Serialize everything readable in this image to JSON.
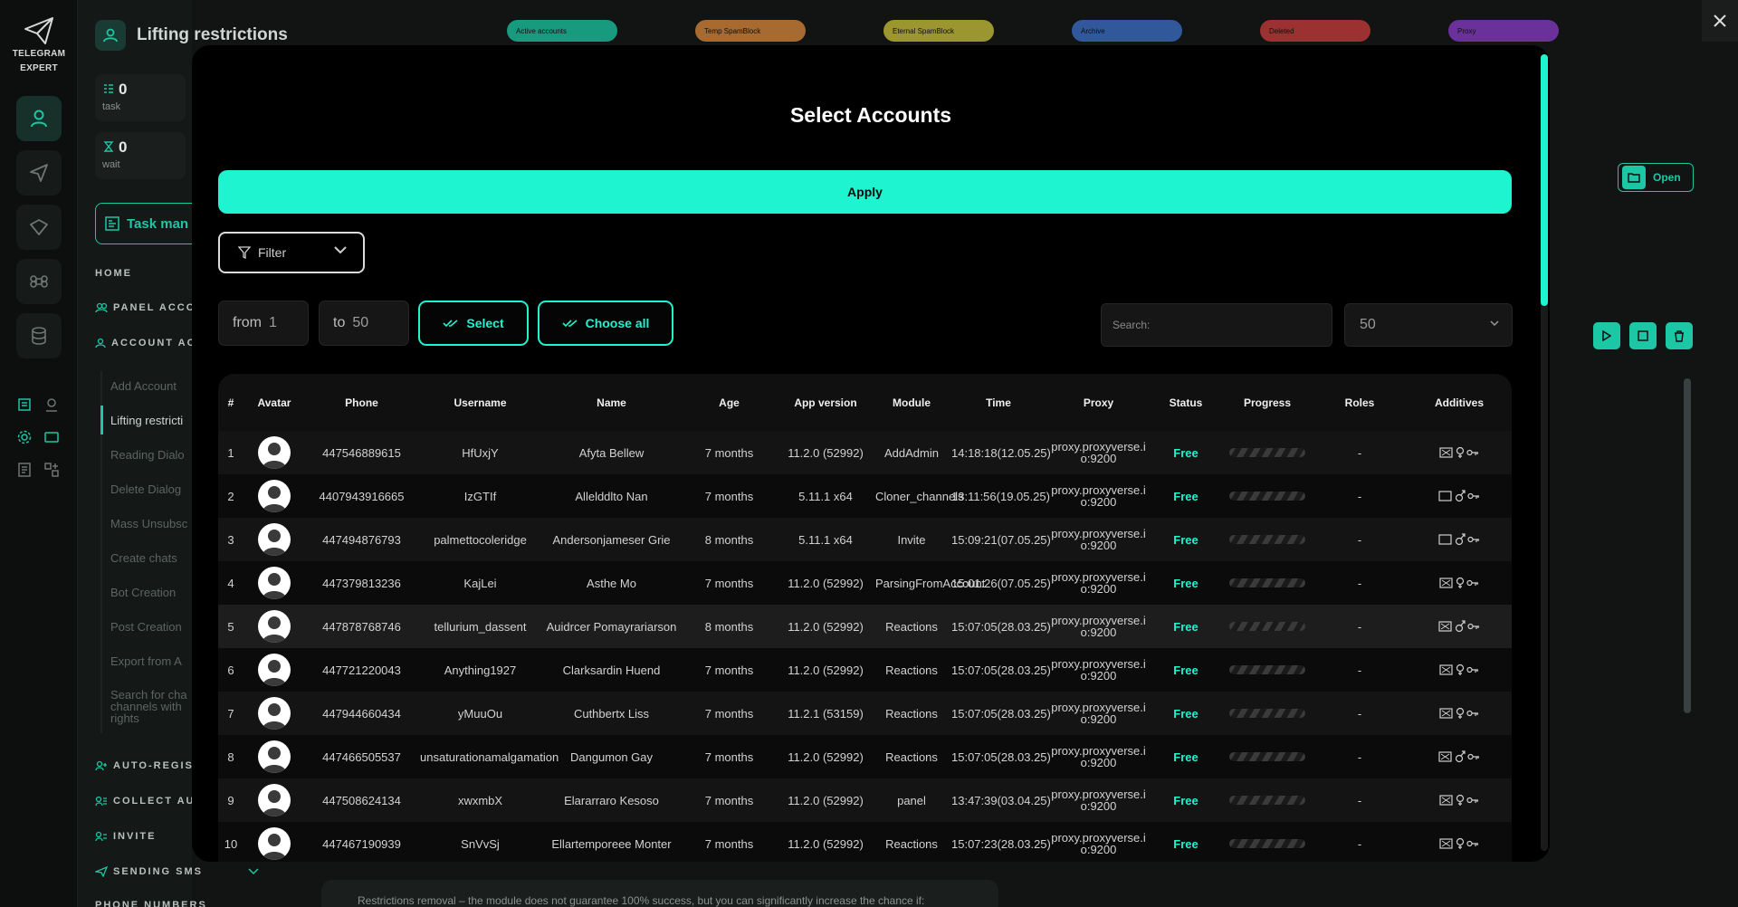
{
  "app": {
    "logo_line1": "TELEGRAM",
    "logo_line2": "EXPERT",
    "page_title": "Lifting restrictions"
  },
  "colors": {
    "accent": "#1ef4cf",
    "accent_dark": "#1bc7a4",
    "modal_bg": "#000000"
  },
  "sidebar": {
    "task_count": "0",
    "task_label": "task",
    "wait_count": "0",
    "wait_label": "wait",
    "task_manager": "Task man",
    "home": "HOME",
    "panel_accounts": "PANEL ACCO",
    "account_actions": "ACCOUNT AC",
    "items": [
      {
        "label": "Add Account"
      },
      {
        "label": "Lifting restricti"
      },
      {
        "label": "Reading Dialo"
      },
      {
        "label": "Delete Dialog"
      },
      {
        "label": "Mass Unsubsc"
      },
      {
        "label": "Create chats"
      },
      {
        "label": "Bot Creation"
      },
      {
        "label": "Post Creation"
      },
      {
        "label": "Export from A"
      },
      {
        "label": "Search for cha channels with rights"
      }
    ],
    "auto_reg": "AUTO-REGIS",
    "collect": "COLLECT AU",
    "invite": "INVITE",
    "sending_sms": "SENDING SMS",
    "phone_numbers": "PHONE NUMBERS"
  },
  "status_pills": [
    {
      "label": "Active accounts",
      "color": "#1bc7a4"
    },
    {
      "label": "Temp SpamBlock",
      "color": "#d9873a"
    },
    {
      "label": "Eternal SpamBlock",
      "color": "#c9c23a"
    },
    {
      "label": "Archive",
      "color": "#3b6fc9"
    },
    {
      "label": "Deleted",
      "color": "#c93b3b"
    },
    {
      "label": "Proxy",
      "color": "#8a3bc9"
    }
  ],
  "background": {
    "open_label": "Open",
    "notice": "Restrictions removal – the module does not guarantee 100% success, but you can significantly increase the chance if:"
  },
  "modal": {
    "title": "Select Accounts",
    "apply_label": "Apply",
    "filter_label": "Filter",
    "from_label": "from",
    "from_value": "1",
    "to_label": "to",
    "to_value": "50",
    "select_label": "Select",
    "choose_all_label": "Choose all",
    "search_placeholder": "Search:",
    "per_page": "50",
    "columns": [
      "#",
      "Avatar",
      "Phone",
      "Username",
      "Name",
      "Age",
      "App version",
      "Module",
      "Time",
      "Proxy",
      "Status",
      "Progress",
      "Roles",
      "Additives"
    ],
    "rows": [
      {
        "n": "1",
        "phone": "447546889615",
        "username": "HfUxjY",
        "name": "Afyta Bellew",
        "age": "7 months",
        "app": "11.2.0 (52992)",
        "module": "AddAdmin",
        "time": "14:18:18(12.05.25)",
        "proxy": "proxy.proxyverse.io:9200",
        "status": "Free",
        "roles": "-",
        "add": "a"
      },
      {
        "n": "2",
        "phone": "4407943916665",
        "username": "IzGTIf",
        "name": "Allelddlto Nan",
        "age": "7 months",
        "app": "5.11.1 x64",
        "module": "Cloner_channels",
        "time": "13:11:56(19.05.25)",
        "proxy": "proxy.proxyverse.io:9200",
        "status": "Free",
        "roles": "-",
        "add": "b"
      },
      {
        "n": "3",
        "phone": "447494876793",
        "username": "palmettocoleridge",
        "name": "Andersonjameser Grie",
        "age": "8 months",
        "app": "5.11.1 x64",
        "module": "Invite",
        "time": "15:09:21(07.05.25)",
        "proxy": "proxy.proxyverse.io:9200",
        "status": "Free",
        "roles": "-",
        "add": "b"
      },
      {
        "n": "4",
        "phone": "447379813236",
        "username": "KajLei",
        "name": "Asthe Mo",
        "age": "7 months",
        "app": "11.2.0 (52992)",
        "module": "ParsingFromAccount",
        "time": "15:01:26(07.05.25)",
        "proxy": "proxy.proxyverse.io:9200",
        "status": "Free",
        "roles": "-",
        "add": "a"
      },
      {
        "n": "5",
        "phone": "447878768746",
        "username": "tellurium_dassent",
        "name": "Auidrcer Pomayrariarson",
        "age": "8 months",
        "app": "11.2.0 (52992)",
        "module": "Reactions",
        "time": "15:07:05(28.03.25)",
        "proxy": "proxy.proxyverse.io:9200",
        "status": "Free",
        "roles": "-",
        "add": "c"
      },
      {
        "n": "6",
        "phone": "447721220043",
        "username": "Anything1927",
        "name": "Clarksardin Huend",
        "age": "7 months",
        "app": "11.2.0 (52992)",
        "module": "Reactions",
        "time": "15:07:05(28.03.25)",
        "proxy": "proxy.proxyverse.io:9200",
        "status": "Free",
        "roles": "-",
        "add": "a"
      },
      {
        "n": "7",
        "phone": "447944660434",
        "username": "yMuuOu",
        "name": "Cuthbertx Liss",
        "age": "7 months",
        "app": "11.2.1 (53159)",
        "module": "Reactions",
        "time": "15:07:05(28.03.25)",
        "proxy": "proxy.proxyverse.io:9200",
        "status": "Free",
        "roles": "-",
        "add": "a"
      },
      {
        "n": "8",
        "phone": "447466505537",
        "username": "unsaturationamalgamation",
        "name": "Dangumon Gay",
        "age": "7 months",
        "app": "11.2.0 (52992)",
        "module": "Reactions",
        "time": "15:07:05(28.03.25)",
        "proxy": "proxy.proxyverse.io:9200",
        "status": "Free",
        "roles": "-",
        "add": "c"
      },
      {
        "n": "9",
        "phone": "447508624134",
        "username": "xwxmbX",
        "name": "Elararraro Kesoso",
        "age": "7 months",
        "app": "11.2.0 (52992)",
        "module": "panel",
        "time": "13:47:39(03.04.25)",
        "proxy": "proxy.proxyverse.io:9200",
        "status": "Free",
        "roles": "-",
        "add": "a"
      },
      {
        "n": "10",
        "phone": "447467190939",
        "username": "SnVvSj",
        "name": "Ellartemporeee Monter",
        "age": "7 months",
        "app": "11.2.0 (52992)",
        "module": "Reactions",
        "time": "15:07:23(28.03.25)",
        "proxy": "proxy.proxyverse.io:9200",
        "status": "Free",
        "roles": "-",
        "add": "a"
      }
    ]
  }
}
